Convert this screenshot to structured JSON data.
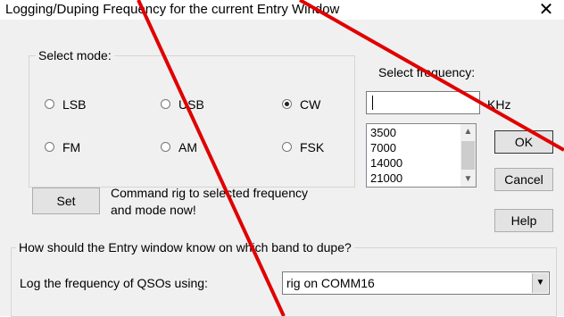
{
  "window": {
    "title": "Logging/Duping Frequency for the current Entry Window",
    "close_glyph": "✕"
  },
  "mode_group": {
    "legend": "Select mode:",
    "options": [
      {
        "label": "LSB",
        "selected": false
      },
      {
        "label": "USB",
        "selected": false
      },
      {
        "label": "CW",
        "selected": true
      },
      {
        "label": "FM",
        "selected": false
      },
      {
        "label": "AM",
        "selected": false
      },
      {
        "label": "FSK",
        "selected": false
      }
    ]
  },
  "frequency": {
    "label": "Select frequency:",
    "input_value": "",
    "unit": "KHz",
    "list": [
      "3500",
      "7000",
      "14000",
      "21000"
    ],
    "scroll_up": "▲",
    "scroll_down": "▼"
  },
  "set_row": {
    "button_label": "Set",
    "text": "Command rig to selected frequency and mode now!"
  },
  "buttons": {
    "ok": "OK",
    "cancel": "Cancel",
    "help": "Help"
  },
  "band_group": {
    "legend": "How should the Entry window know on which band to dupe?",
    "log_label": "Log the frequency of QSOs using:",
    "combo_value": "rig on COMM16",
    "combo_arrow": "▼"
  },
  "colors": {
    "annotation_line": "#e00000",
    "dialog_bg": "#f0f0f0"
  }
}
